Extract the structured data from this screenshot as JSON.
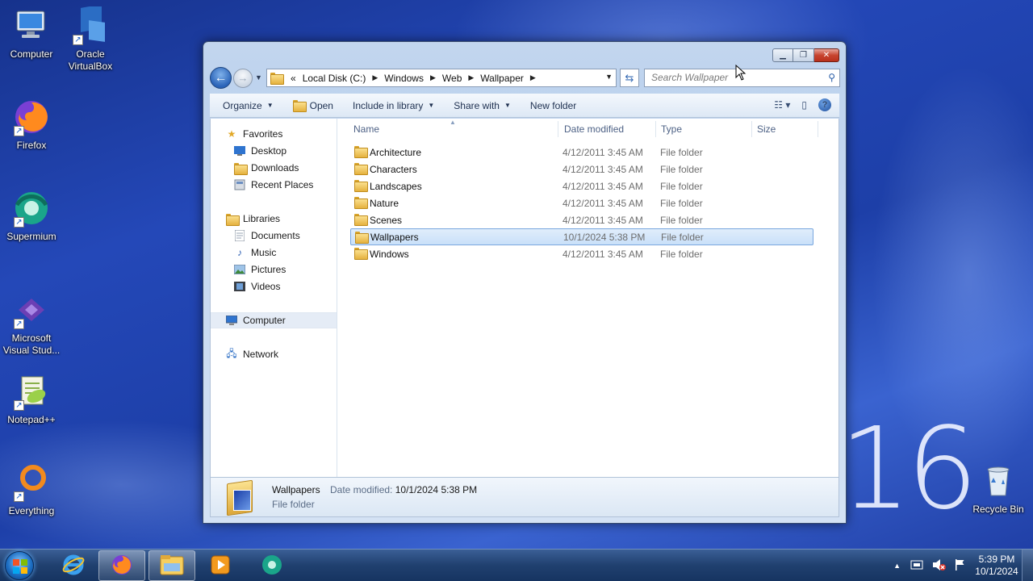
{
  "desktop": {
    "icons": [
      {
        "label": "Computer"
      },
      {
        "label": "Oracle VirtualBox"
      },
      {
        "label": "Firefox"
      },
      {
        "label": "Supermium"
      },
      {
        "label": "Microsoft Visual Stud..."
      },
      {
        "label": "Notepad++"
      },
      {
        "label": "Everything"
      },
      {
        "label": "Recycle Bin"
      }
    ],
    "wallpaper_text": "16"
  },
  "window": {
    "controls": {
      "minimize": "minimize-icon",
      "maximize": "maximize-icon",
      "close": "close-icon"
    },
    "address": {
      "overflow": "«",
      "crumbs": [
        "Local Disk (C:)",
        "Windows",
        "Web",
        "Wallpaper"
      ]
    },
    "search": {
      "placeholder": "Search Wallpaper"
    },
    "toolbar": {
      "organize": "Organize",
      "open": "Open",
      "include": "Include in library",
      "share": "Share with",
      "new_folder": "New folder"
    },
    "navpane": {
      "favorites": "Favorites",
      "desktop": "Desktop",
      "downloads": "Downloads",
      "recent": "Recent Places",
      "libraries": "Libraries",
      "documents": "Documents",
      "music": "Music",
      "pictures": "Pictures",
      "videos": "Videos",
      "computer": "Computer",
      "network": "Network"
    },
    "columns": {
      "name": "Name",
      "date": "Date modified",
      "type": "Type",
      "size": "Size"
    },
    "files": [
      {
        "name": "Architecture",
        "date": "4/12/2011 3:45 AM",
        "type": "File folder"
      },
      {
        "name": "Characters",
        "date": "4/12/2011 3:45 AM",
        "type": "File folder"
      },
      {
        "name": "Landscapes",
        "date": "4/12/2011 3:45 AM",
        "type": "File folder"
      },
      {
        "name": "Nature",
        "date": "4/12/2011 3:45 AM",
        "type": "File folder"
      },
      {
        "name": "Scenes",
        "date": "4/12/2011 3:45 AM",
        "type": "File folder"
      },
      {
        "name": "Wallpapers",
        "date": "10/1/2024 5:38 PM",
        "type": "File folder"
      },
      {
        "name": "Windows",
        "date": "4/12/2011 3:45 AM",
        "type": "File folder"
      }
    ],
    "selected_file": "Wallpapers",
    "details": {
      "name": "Wallpapers",
      "modified_label": "Date modified:",
      "modified_value": "10/1/2024 5:38 PM",
      "type": "File folder"
    }
  },
  "taskbar": {
    "clock_time": "5:39 PM",
    "clock_date": "10/1/2024"
  }
}
